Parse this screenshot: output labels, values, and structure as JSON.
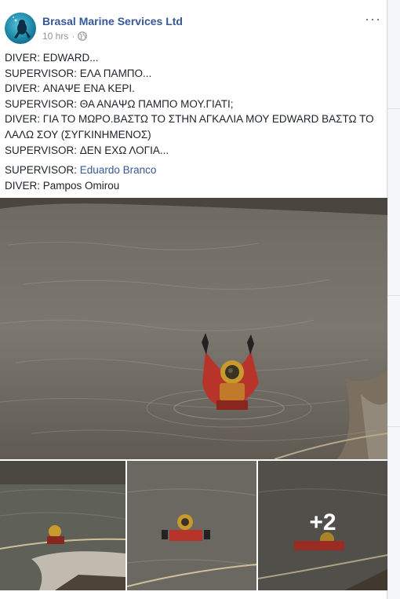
{
  "post": {
    "page_name": "Brasal Marine Services Ltd",
    "time": "10 hrs",
    "separator": "·",
    "more_label": "···",
    "lines": [
      "DIVER: EDWARD...",
      "SUPERVISOR: ΕΛΑ ΠΑΜΠΟ...",
      "DIVER: ΑΝΑΨΕ ΕΝΑ ΚΕΡΙ.",
      "SUPERVISOR: ΘΑ ΑΝΑΨΩ ΠΑΜΠΟ ΜΟΥ.ΓΙΑΤΙ;",
      "DIVER: ΓΙΑ ΤΟ ΜΩΡΟ.ΒΑΣΤΩ ΤΟ ΣΤΗΝ ΑΓΚΑΛΙΑ ΜΟΥ EDWARD ΒΑΣΤΩ ΤΟ ΛΑΛΩ ΣΟΥ (ΣΥΓΚΙΝΗΜΕΝΟΣ)",
      "SUPERVISOR: ΔΕΝ ΕΧΩ ΛΟΓΙΑ..."
    ],
    "credits": [
      {
        "role": "SUPERVISOR:",
        "name": "Eduardo Branco"
      },
      {
        "role": "DIVER:",
        "name": "Pampos Omirou"
      }
    ],
    "more_photos": "+2"
  },
  "colors": {
    "link": "#365899",
    "text": "#1d2129",
    "meta": "#90949c",
    "suit": "#b8342a",
    "helmet": "#c89a2e"
  },
  "icons": {
    "privacy": "globe-icon",
    "options": "more-options-icon"
  }
}
